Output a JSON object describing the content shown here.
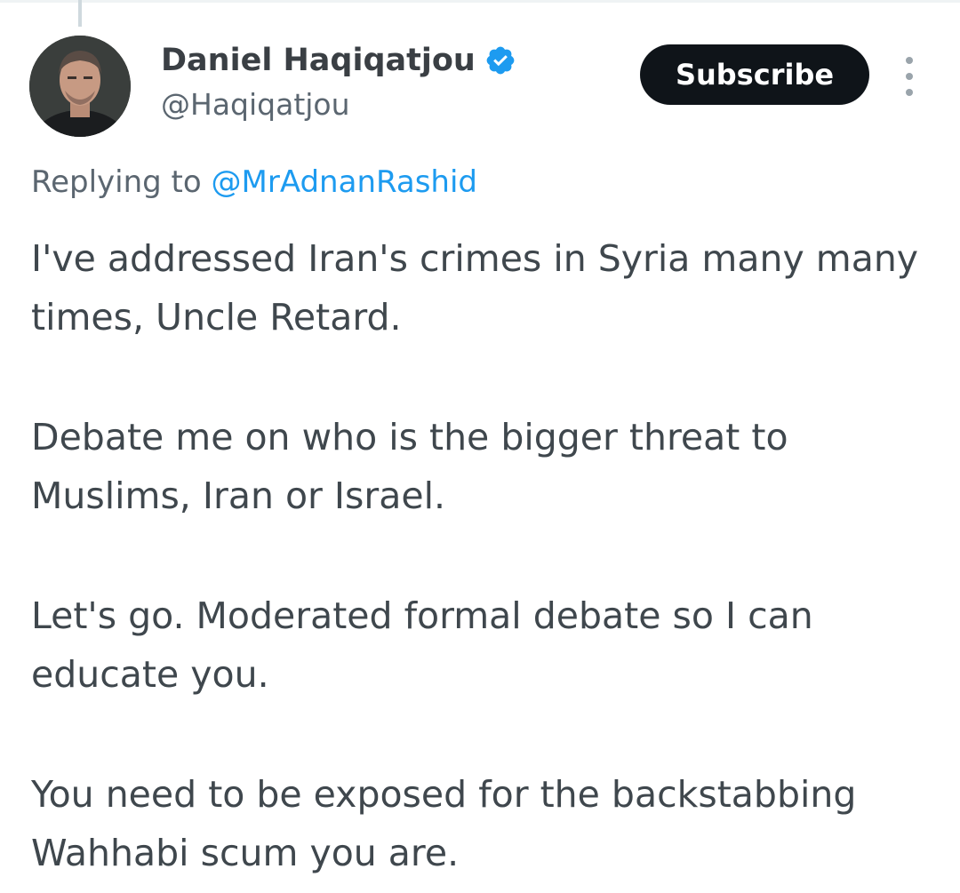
{
  "author": {
    "display_name": "Daniel Haqiqatjou",
    "handle": "@Haqiqatjou",
    "verified": true,
    "avatar_icon": "profile-photo"
  },
  "actions": {
    "subscribe_label": "Subscribe",
    "more_icon": "more-vertical-icon"
  },
  "reply": {
    "prefix": "Replying to ",
    "handle": "@MrAdnanRashid"
  },
  "tweet": {
    "paragraphs": [
      "I've addressed Iran's crimes in Syria many many times, Uncle Retard.",
      "Debate me on who is the bigger threat to Muslims, Iran or Israel.",
      "Let's go. Moderated formal debate so I can educate you.",
      "You need to be exposed for the backstabbing Wahhabi scum you are."
    ]
  },
  "colors": {
    "link": "#1d9bf0",
    "button_bg": "#0f1419",
    "secondary_text": "#5b6670"
  }
}
